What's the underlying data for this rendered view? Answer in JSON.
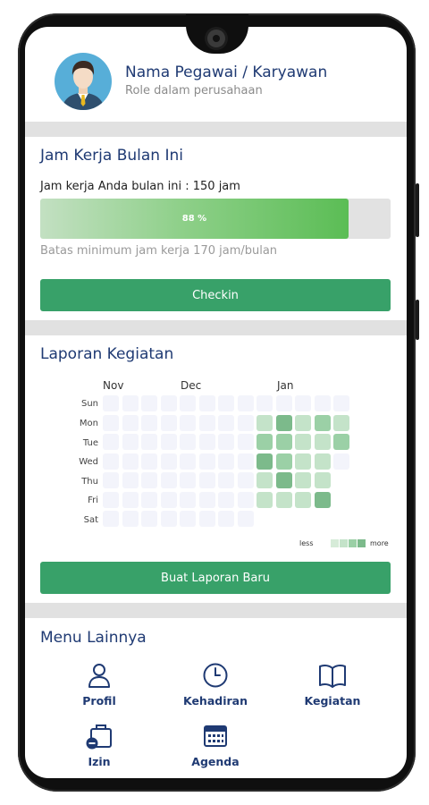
{
  "profile": {
    "name": "Nama Pegawai / Karyawan",
    "role": "Role dalam perusahaan"
  },
  "work_hours": {
    "title": "Jam Kerja Bulan Ini",
    "summary": "Jam kerja Anda bulan ini : 150 jam",
    "progress_label": "88 %",
    "progress_fraction": 0.88,
    "minimum_note": "Batas minimum jam kerja 170 jam/bulan",
    "checkin_label": "Checkin"
  },
  "activity": {
    "title": "Laporan Kegiatan",
    "months": [
      "Nov",
      "Dec",
      "Jan"
    ],
    "days": [
      "Sun",
      "Mon",
      "Tue",
      "Wed",
      "Thu",
      "Fri",
      "Sat"
    ],
    "heatmap_levels": [
      [
        0,
        0,
        0,
        0,
        0,
        0,
        0,
        0,
        0,
        0,
        0,
        0,
        0
      ],
      [
        0,
        0,
        0,
        0,
        0,
        0,
        0,
        0,
        1,
        3,
        1,
        2,
        1
      ],
      [
        0,
        0,
        0,
        0,
        0,
        0,
        0,
        0,
        2,
        2,
        1,
        1,
        2
      ],
      [
        0,
        0,
        0,
        0,
        0,
        0,
        0,
        0,
        3,
        2,
        1,
        1,
        0
      ],
      [
        0,
        0,
        0,
        0,
        0,
        0,
        0,
        0,
        1,
        3,
        1,
        1,
        -1
      ],
      [
        0,
        0,
        0,
        0,
        0,
        0,
        0,
        0,
        1,
        1,
        1,
        3,
        -1
      ],
      [
        0,
        0,
        0,
        0,
        0,
        0,
        0,
        0,
        -1,
        -1,
        -1,
        -1,
        -1
      ]
    ],
    "level_colors": [
      "#f3f4fb",
      "#c4e3c9",
      "#9bd0a6",
      "#7cba8b"
    ],
    "legend_less": "less",
    "legend_more": "more",
    "new_report_label": "Buat Laporan Baru"
  },
  "menu": {
    "title": "Menu Lainnya",
    "items": [
      {
        "label": "Profil",
        "icon": "user-icon"
      },
      {
        "label": "Kehadiran",
        "icon": "clock-icon"
      },
      {
        "label": "Kegiatan",
        "icon": "book-icon"
      },
      {
        "label": "Izin",
        "icon": "leave-bag-icon"
      },
      {
        "label": "Agenda",
        "icon": "calendar-icon"
      }
    ]
  },
  "colors": {
    "accent_green": "#38a169",
    "title_navy": "#1f3a73"
  }
}
